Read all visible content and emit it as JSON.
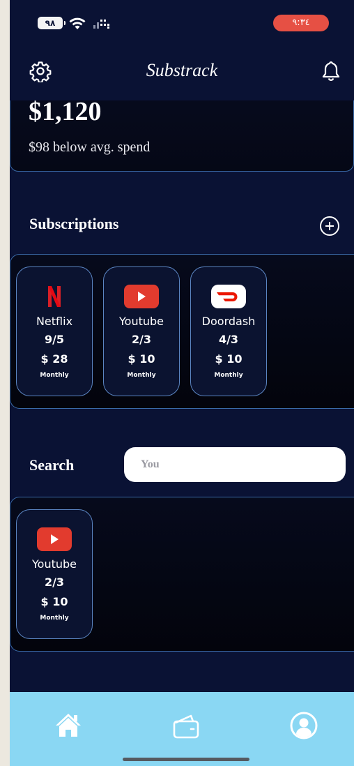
{
  "status": {
    "battery": "٩٨",
    "time": "٩:٣٤"
  },
  "header": {
    "title": "Substrack"
  },
  "spend": {
    "amount": "$1,120",
    "note": "$98 below avg. spend"
  },
  "subscriptions": {
    "title": "Subscriptions",
    "items": [
      {
        "name": "Netflix",
        "date": "9/5",
        "price": "$ 28",
        "cycle": "Monthly",
        "logo": "netflix-logo"
      },
      {
        "name": "Youtube",
        "date": "2/3",
        "price": "$ 10",
        "cycle": "Monthly",
        "logo": "youtube-logo"
      },
      {
        "name": "Doordash",
        "date": "4/3",
        "price": "$ 10",
        "cycle": "Monthly",
        "logo": "doordash-logo"
      }
    ]
  },
  "search": {
    "label": "Search",
    "value": "You",
    "results": [
      {
        "name": "Youtube",
        "date": "2/3",
        "price": "$ 10",
        "cycle": "Monthly",
        "logo": "youtube-logo"
      }
    ]
  },
  "colors": {
    "background": "#0a1234",
    "accent_border": "#3a6aa8",
    "nav_bar": "#8ad7f3",
    "time_pill": "#e65044"
  }
}
